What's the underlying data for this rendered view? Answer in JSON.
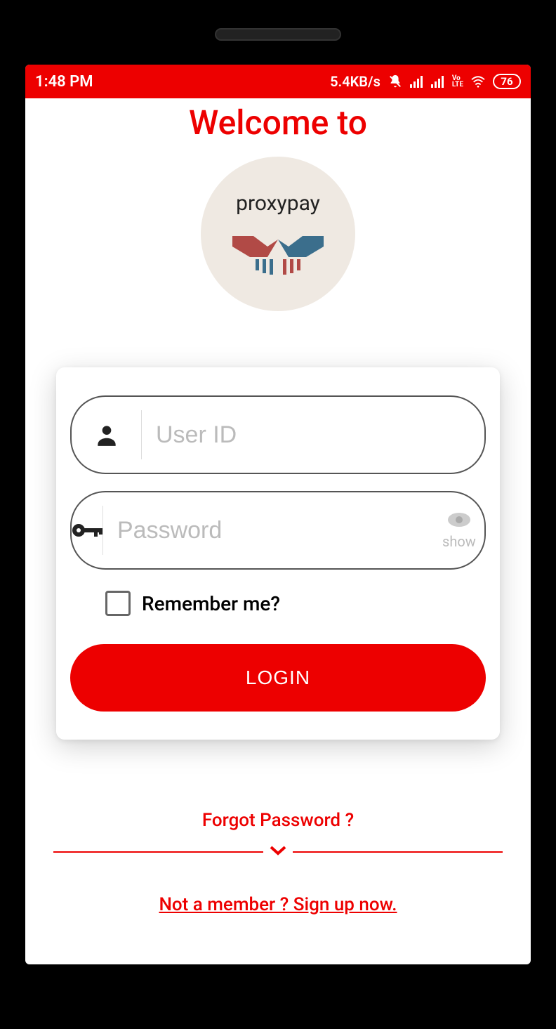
{
  "status": {
    "time": "1:48 PM",
    "data_rate": "5.4KB/s",
    "battery": "76",
    "volte": "Vo LTE"
  },
  "header": {
    "welcome": "Welcome to",
    "brand": "proxypay"
  },
  "form": {
    "userid_placeholder": "User ID",
    "password_placeholder": "Password",
    "show_label": "show",
    "remember_label": "Remember me?",
    "login_label": "LOGIN"
  },
  "links": {
    "forgot": "Forgot Password ?",
    "signup": "Not a member ? Sign up now."
  }
}
